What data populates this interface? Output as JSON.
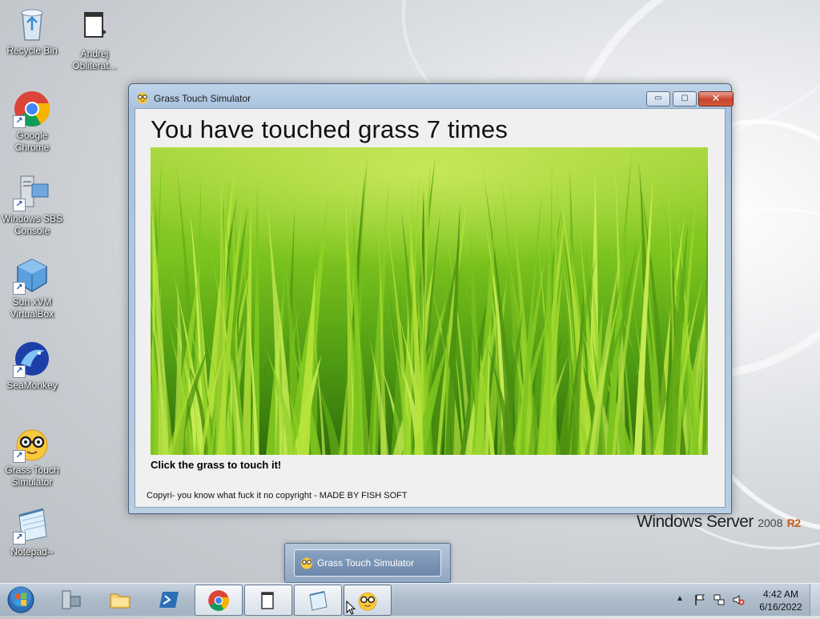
{
  "desktop": {
    "icons": [
      {
        "label": "Recycle Bin",
        "icon": "recycle-bin-icon"
      },
      {
        "label": "Andrej\nObliterat...",
        "icon": "folder-icon"
      },
      {
        "label": "Google\nChrome",
        "icon": "chrome-icon"
      },
      {
        "label": "Windows SBS\nConsole",
        "icon": "sbs-console-icon"
      },
      {
        "label": "Sun xVM\nVirtualBox",
        "icon": "virtualbox-icon"
      },
      {
        "label": "SeaMonkey",
        "icon": "seamonkey-icon"
      },
      {
        "label": "Grass Touch\nSimulator",
        "icon": "nerd-face-icon"
      },
      {
        "label": "Notepad--",
        "icon": "notepad-icon"
      }
    ],
    "os_logo": {
      "brand": "Windows Server",
      "year": "2008",
      "edition": "R2"
    }
  },
  "window": {
    "title": "Grass Touch Simulator",
    "controls": {
      "minimize": "▭",
      "maximize": "▢",
      "close": "✕"
    },
    "headline": "You have touched grass 7 times",
    "instruction": "Click the grass to touch it!",
    "copyright": "Copyri- you know what fuck it no copyright - MADE BY FISH SOFT"
  },
  "taskbar": {
    "preview_label": "Grass Touch Simulator",
    "pinned": [
      "server-manager-icon",
      "explorer-icon",
      "powershell-icon",
      "chrome-icon",
      "folder-icon",
      "notepad-icon",
      "nerd-face-icon"
    ],
    "clock": {
      "time": "4:42 AM",
      "date": "6/16/2022"
    },
    "tray_icons": [
      "chevron-up-icon",
      "flag-icon",
      "network-icon",
      "volume-muted-icon"
    ]
  },
  "colors": {
    "accent": "#c7432a",
    "titlebar": "#bfd4ea",
    "grass": "#6cc21c"
  }
}
